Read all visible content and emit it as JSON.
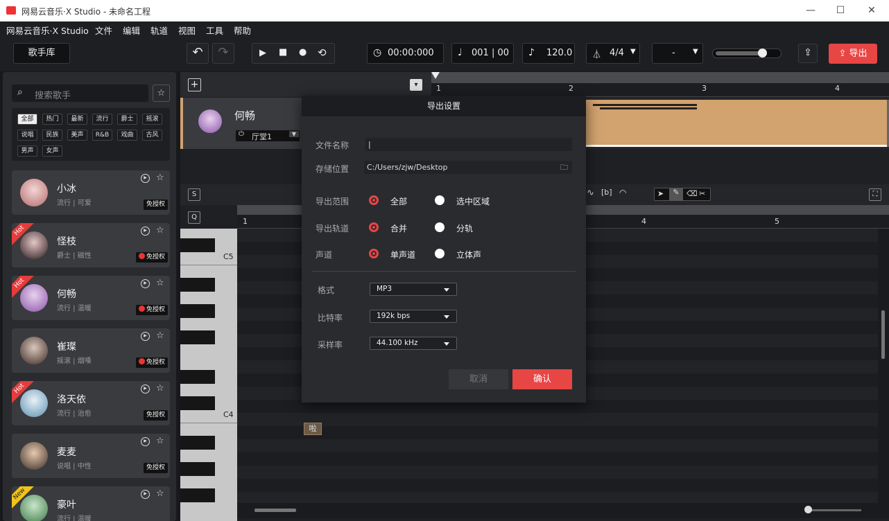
{
  "window": {
    "title": "网易云音乐·X Studio - 未命名工程"
  },
  "menu": [
    "网易云音乐·X Studio",
    "文件",
    "编辑",
    "轨道",
    "视图",
    "工具",
    "帮助"
  ],
  "toolbar": {
    "singer_lib": "歌手库",
    "time": "00:00:000",
    "measure": "001 | 00",
    "tempo": "120.0",
    "time_sig": "4/4",
    "key": "-",
    "export": "导出"
  },
  "sidebar": {
    "search_placeholder": "搜索歌手",
    "tags": [
      "全部",
      "热门",
      "最新",
      "流行",
      "爵士",
      "摇滚",
      "说唱",
      "民族",
      "美声",
      "R&B",
      "戏曲",
      "古风",
      "男声",
      "女声"
    ],
    "singers": [
      {
        "name": "小冰",
        "genre": "流行 | 可爱",
        "badge": "免授权",
        "hot": false,
        "new": false,
        "paid": false
      },
      {
        "name": "怪枝",
        "genre": "爵士 | 磁性",
        "badge": "免授权",
        "hot": true,
        "new": false,
        "paid": true
      },
      {
        "name": "何畅",
        "genre": "流行 | 温暖",
        "badge": "免授权",
        "hot": true,
        "new": false,
        "paid": true
      },
      {
        "name": "崔璨",
        "genre": "摇滚 | 烟嗓",
        "badge": "免授权",
        "hot": false,
        "new": false,
        "paid": true
      },
      {
        "name": "洛天依",
        "genre": "流行 | 治愈",
        "badge": "免授权",
        "hot": true,
        "new": false,
        "paid": false
      },
      {
        "name": "麦麦",
        "genre": "说唱 | 中性",
        "badge": "免授权",
        "hot": false,
        "new": false,
        "paid": false
      },
      {
        "name": "豪叶",
        "genre": "流行 | 温暖",
        "badge": "免授权",
        "hot": false,
        "new": true,
        "paid": false
      }
    ],
    "hot_label": "Hot",
    "new_label": "New"
  },
  "track": {
    "singer": "何畅",
    "room": "厅堂1",
    "ruler": [
      "1",
      "2",
      "3",
      "4"
    ]
  },
  "pianoroll": {
    "ruler": [
      "1",
      "4",
      "5"
    ],
    "keys": [
      "C5",
      "C4"
    ],
    "note": "啦",
    "s_btn": "S",
    "q_btn": "Q",
    "b_btn": "[b]"
  },
  "dialog": {
    "title": "导出设置",
    "file_name_label": "文件名称",
    "file_name_value": "|",
    "location_label": "存储位置",
    "location_value": "C:/Users/zjw/Desktop",
    "range_label": "导出范围",
    "range_all": "全部",
    "range_selection": "选中区域",
    "track_label": "导出轨道",
    "track_merge": "合并",
    "track_split": "分轨",
    "channel_label": "声道",
    "channel_mono": "单声道",
    "channel_stereo": "立体声",
    "format_label": "格式",
    "format_value": "MP3",
    "bitrate_label": "比特率",
    "bitrate_value": "192k bps",
    "samplerate_label": "采样率",
    "samplerate_value": "44.100 kHz",
    "cancel": "取消",
    "confirm": "确认"
  },
  "colors": {
    "accent": "#e84545",
    "clip": "#d2a26f",
    "bg": "#1f2023"
  }
}
